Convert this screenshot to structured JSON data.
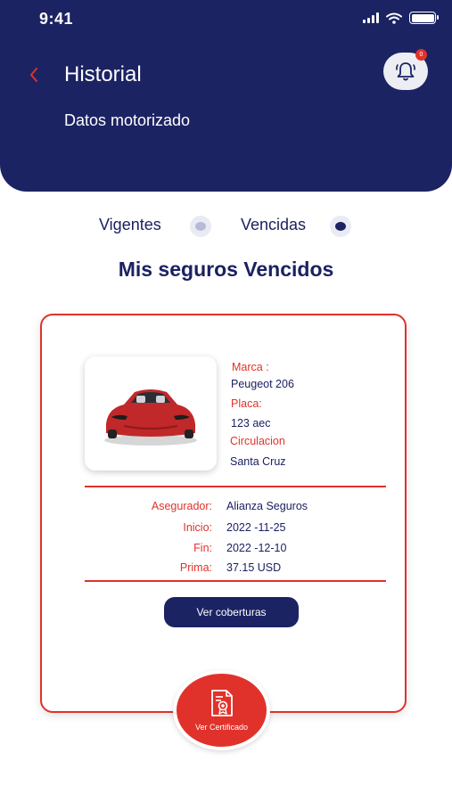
{
  "status_bar": {
    "time": "9:41"
  },
  "header": {
    "title": "Historial",
    "subtitle": "Datos motorizado",
    "notification_count": "0"
  },
  "toggle": {
    "option1": "Vigentes",
    "option2": "Vencidas",
    "selected": "Vencidas"
  },
  "section_title": "Mis seguros Vencidos",
  "vehicle": {
    "marca_label": "Marca :",
    "marca_value": "Peugeot 206",
    "placa_label": "Placa:",
    "placa_value": "123 aec",
    "circulacion_label": "Circulacion",
    "circulacion_value": "Santa Cruz"
  },
  "policy": {
    "asegurador_label": "Asegurador:",
    "asegurador_value": "Alianza Seguros",
    "inicio_label": "Inicio:",
    "inicio_value": "2022 -11-25",
    "fin_label": "Fin:",
    "fin_value": "2022 -12-10",
    "prima_label": "Prima:",
    "prima_value": "37.15 USD"
  },
  "buttons": {
    "coberturas": "Ver coberturas",
    "certificado": "Ver Certificado"
  },
  "colors": {
    "primary": "#1c2363",
    "accent": "#e0322b",
    "radio_inactive": "#b5bbd6"
  },
  "icons": {
    "back": "chevron-left-icon",
    "bell": "bell-icon",
    "certificate": "certificate-icon"
  }
}
